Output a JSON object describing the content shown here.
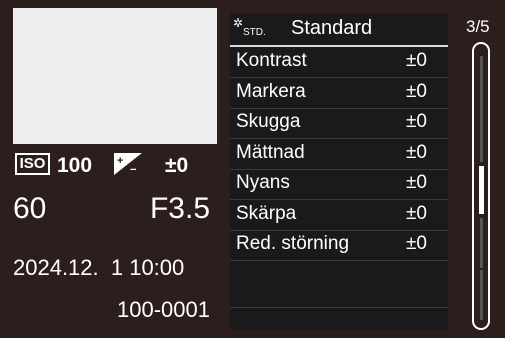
{
  "left": {
    "iso_label": "ISO",
    "iso_value": "100",
    "exposure_comp": "±0",
    "shutter": "60",
    "aperture": "F3.5",
    "datetime": "2024.12.  1 10:00",
    "file_number": "100-0001"
  },
  "menu": {
    "style_icon_text": "STD.",
    "title": "Standard",
    "rows": [
      {
        "label": "Kontrast",
        "value": "±0"
      },
      {
        "label": "Markera",
        "value": "±0"
      },
      {
        "label": "Skugga",
        "value": "±0"
      },
      {
        "label": "Mättnad",
        "value": "±0"
      },
      {
        "label": "Nyans",
        "value": "±0"
      },
      {
        "label": "Skärpa",
        "value": "±0"
      },
      {
        "label": "Red. störning",
        "value": "±0"
      }
    ],
    "page": "3/5"
  }
}
